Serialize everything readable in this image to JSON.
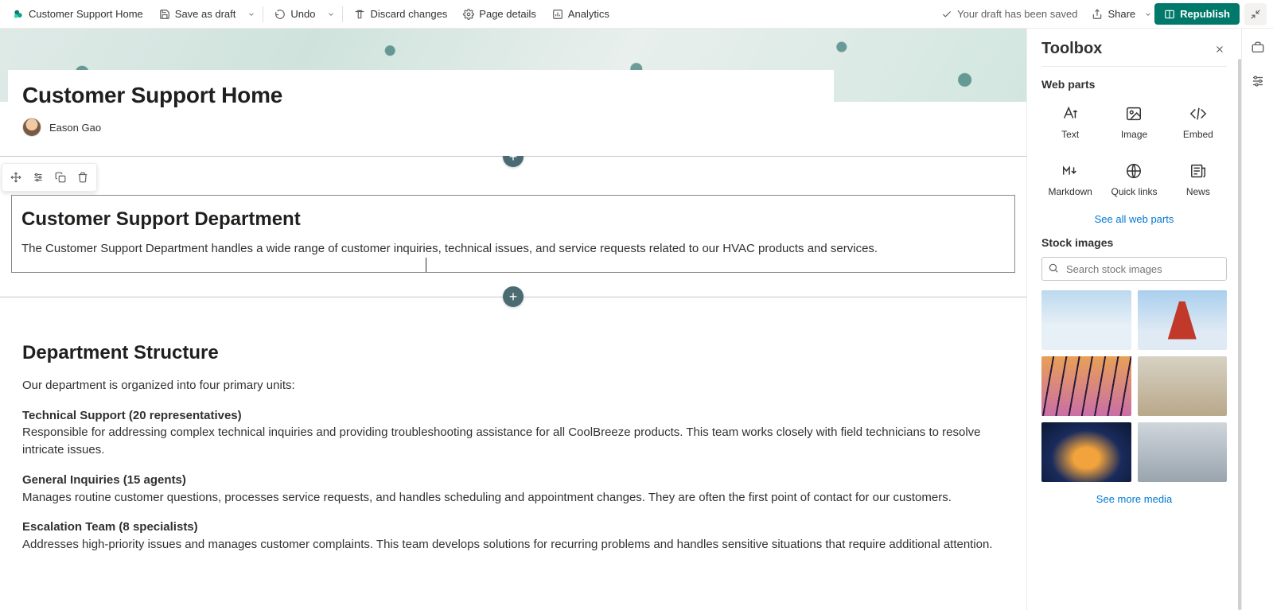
{
  "toolbar": {
    "site_label": "Customer Support Home",
    "save_label": "Save as draft",
    "undo_label": "Undo",
    "discard_label": "Discard changes",
    "details_label": "Page details",
    "analytics_label": "Analytics",
    "status_text": "Your draft has been saved",
    "share_label": "Share",
    "republish_label": "Republish"
  },
  "page": {
    "title": "Customer Support Home",
    "author": "Eason Gao"
  },
  "webpart": {
    "heading": "Customer Support Department",
    "body": "The Customer Support Department handles a wide range of customer inquiries, technical issues, and service requests related to our HVAC products and services."
  },
  "content": {
    "structure_heading": "Department Structure",
    "intro": "Our department is organized into four primary units:",
    "units": [
      {
        "title": "Technical Support (20 representatives)",
        "desc": "Responsible for addressing complex technical inquiries and providing troubleshooting assistance for all CoolBreeze products. This team works closely with field technicians to resolve intricate issues."
      },
      {
        "title": "General Inquiries (15 agents)",
        "desc": "Manages routine customer questions, processes service requests, and handles scheduling and appointment changes. They are often the first point of contact for our customers."
      },
      {
        "title": "Escalation Team (8 specialists)",
        "desc": "Addresses high-priority issues and manages customer complaints. This team develops solutions for recurring problems and handles sensitive situations that require additional attention."
      }
    ]
  },
  "toolbox": {
    "title": "Toolbox",
    "webparts_label": "Web parts",
    "items": [
      {
        "label": "Text"
      },
      {
        "label": "Image"
      },
      {
        "label": "Embed"
      },
      {
        "label": "Markdown"
      },
      {
        "label": "Quick links"
      },
      {
        "label": "News"
      }
    ],
    "see_all": "See all web parts",
    "stock_label": "Stock images",
    "search_placeholder": "Search stock images",
    "see_more_media": "See more media"
  }
}
